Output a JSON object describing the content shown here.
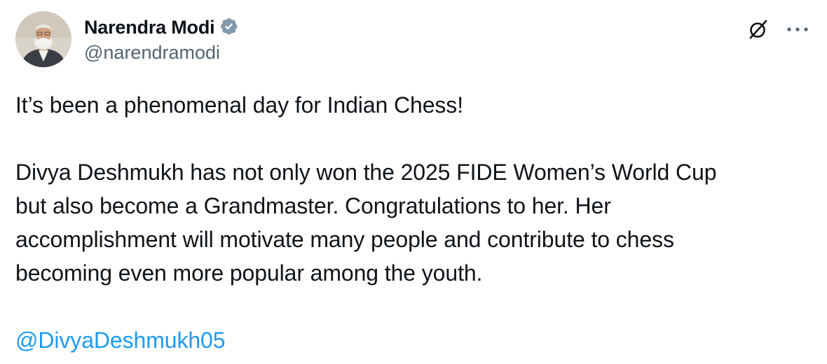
{
  "author": {
    "display_name": "Narendra Modi",
    "handle": "@narendramodi",
    "verified_badge_color": "#829aab"
  },
  "header_actions": {
    "grok_icon": "grok-icon",
    "more_icon": "more-horizontal-icon"
  },
  "tweet": {
    "paragraph_1": "It’s been a phenomenal day for Indian Chess!",
    "paragraph_2_lines": [
      "Divya Deshmukh has not only won the 2025 FIDE Women’s World Cup",
      "but also become a Grandmaster. Congratulations to her. Her",
      "accomplishment will motivate many people and contribute to chess",
      "becoming even more popular among the youth."
    ],
    "mention": "@DivyaDeshmukh05"
  },
  "colors": {
    "text": "#0f1419",
    "secondary": "#536471",
    "link": "#1d9bf0"
  }
}
